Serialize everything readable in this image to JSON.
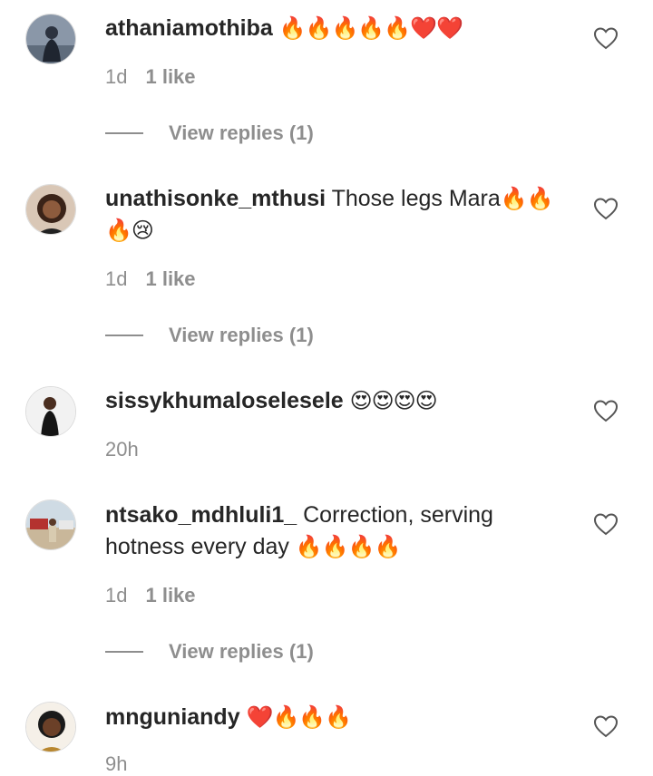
{
  "comments": [
    {
      "username": "athaniamothiba",
      "text": "",
      "emoji": "🔥🔥🔥🔥🔥❤️❤️",
      "time": "1d",
      "likes": "1 like",
      "replies": "View replies (1)"
    },
    {
      "username": "unathisonke_mthusi",
      "text": "Those legs Mara",
      "emoji": "🔥🔥🔥😢",
      "time": "1d",
      "likes": "1 like",
      "replies": "View replies (1)"
    },
    {
      "username": "sissykhumaloselesele",
      "text": "",
      "emoji": "😍😍😍😍",
      "time": "20h",
      "likes": "",
      "replies": ""
    },
    {
      "username": "ntsako_mdhluli1_",
      "text": "Correction, serving hotness every day",
      "emoji": "🔥🔥🔥🔥",
      "time": "1d",
      "likes": "1 like",
      "replies": "View replies (1)"
    },
    {
      "username": "mnguniandy",
      "text": "",
      "emoji": "❤️🔥🔥🔥",
      "time": "9h",
      "likes": "",
      "replies": ""
    }
  ],
  "icons": {
    "like": "heart-outline-icon"
  },
  "colors": {
    "text": "#262626",
    "muted": "#8e8e8e"
  }
}
